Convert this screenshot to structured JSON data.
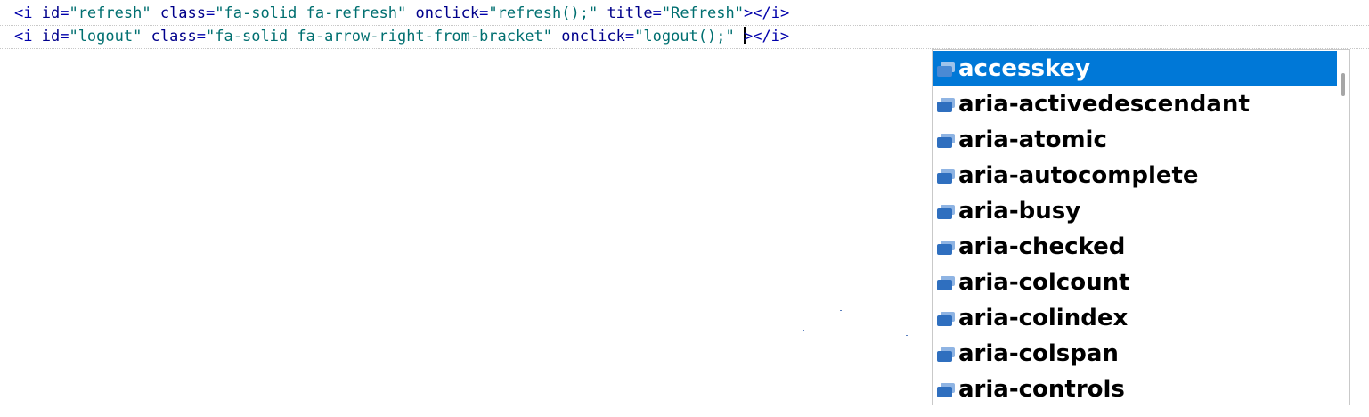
{
  "editor": {
    "lines": [
      {
        "segments": [
          {
            "kind": "tag",
            "text": "<i "
          },
          {
            "kind": "attr",
            "text": "id"
          },
          {
            "kind": "eq",
            "text": "="
          },
          {
            "kind": "val",
            "text": "\"refresh\""
          },
          {
            "kind": "plain",
            "text": " "
          },
          {
            "kind": "attr",
            "text": "class"
          },
          {
            "kind": "eq",
            "text": "="
          },
          {
            "kind": "val",
            "text": "\"fa-solid fa-refresh\""
          },
          {
            "kind": "plain",
            "text": " "
          },
          {
            "kind": "attr",
            "text": "onclick"
          },
          {
            "kind": "eq",
            "text": "="
          },
          {
            "kind": "val",
            "text": "\"refresh();\""
          },
          {
            "kind": "plain",
            "text": " "
          },
          {
            "kind": "attr",
            "text": "title"
          },
          {
            "kind": "eq",
            "text": "="
          },
          {
            "kind": "val",
            "text": "\"Refresh\""
          },
          {
            "kind": "tag",
            "text": "></i>"
          }
        ]
      },
      {
        "segments": [
          {
            "kind": "tag",
            "text": "<i "
          },
          {
            "kind": "attr",
            "text": "id"
          },
          {
            "kind": "eq",
            "text": "="
          },
          {
            "kind": "val",
            "text": "\"logout\""
          },
          {
            "kind": "plain",
            "text": " "
          },
          {
            "kind": "attr",
            "text": "class"
          },
          {
            "kind": "eq",
            "text": "="
          },
          {
            "kind": "val",
            "text": "\"fa-solid fa-arrow-right-from-bracket\""
          },
          {
            "kind": "plain",
            "text": " "
          },
          {
            "kind": "attr",
            "text": "onclick"
          },
          {
            "kind": "eq",
            "text": "="
          },
          {
            "kind": "val",
            "text": "\"logout();\""
          },
          {
            "kind": "plain",
            "text": " "
          },
          {
            "kind": "caret",
            "text": ""
          },
          {
            "kind": "tag",
            "text": "></i>"
          }
        ]
      }
    ]
  },
  "autocomplete": {
    "selected_index": 0,
    "items": [
      {
        "label": "accesskey",
        "icon": "attribute-icon"
      },
      {
        "label": "aria-activedescendant",
        "icon": "attribute-icon"
      },
      {
        "label": "aria-atomic",
        "icon": "attribute-icon"
      },
      {
        "label": "aria-autocomplete",
        "icon": "attribute-icon"
      },
      {
        "label": "aria-busy",
        "icon": "attribute-icon"
      },
      {
        "label": "aria-checked",
        "icon": "attribute-icon"
      },
      {
        "label": "aria-colcount",
        "icon": "attribute-icon"
      },
      {
        "label": "aria-colindex",
        "icon": "attribute-icon"
      },
      {
        "label": "aria-colspan",
        "icon": "attribute-icon"
      },
      {
        "label": "aria-controls",
        "icon": "attribute-icon"
      }
    ]
  },
  "colors": {
    "tag": "#0000aa",
    "attribute": "#00008b",
    "value": "#006f70",
    "selection": "#0078d7",
    "icon": "#2f6fbf"
  }
}
